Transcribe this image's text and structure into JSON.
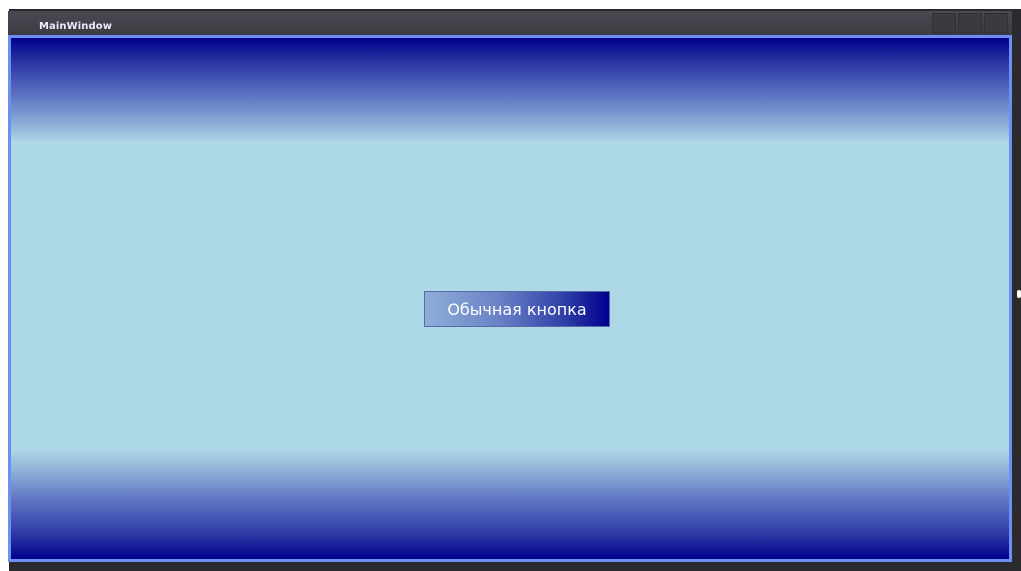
{
  "window": {
    "title": "MainWindow"
  },
  "main": {
    "button_label": "Обычная кнопка"
  },
  "colors": {
    "frame_background": "#2a2a2f",
    "title_bar": "#4b4a52",
    "content_border": "#6b8ff2",
    "gradient_edge": "#00008a",
    "gradient_center": "#add8e6",
    "button_text": "#ffffff"
  }
}
